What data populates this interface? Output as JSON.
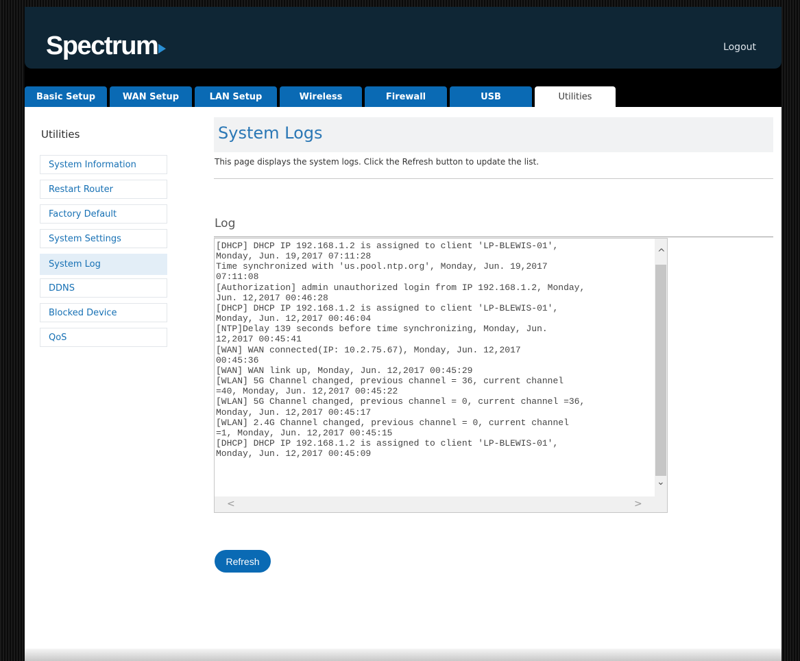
{
  "brand": {
    "logo": "Spectrum"
  },
  "header": {
    "logout": "Logout"
  },
  "tabs": [
    {
      "label": "Basic Setup"
    },
    {
      "label": "WAN Setup"
    },
    {
      "label": "LAN Setup"
    },
    {
      "label": "Wireless"
    },
    {
      "label": "Firewall"
    },
    {
      "label": "USB"
    },
    {
      "label": "Utilities"
    }
  ],
  "sidebar": {
    "title": "Utilities",
    "items": [
      {
        "label": "System Information"
      },
      {
        "label": "Restart Router"
      },
      {
        "label": "Factory Default"
      },
      {
        "label": "System Settings"
      },
      {
        "label": "System Log"
      },
      {
        "label": "DDNS"
      },
      {
        "label": "Blocked Device"
      },
      {
        "label": "QoS"
      }
    ]
  },
  "main": {
    "title": "System Logs",
    "description": "This page displays the system logs. Click the Refresh button to update the list.",
    "log_heading": "Log",
    "log_text": "[DHCP] DHCP IP 192.168.1.2 is assigned to client 'LP-BLEWIS-01',\nMonday, Jun. 19,2017 07:11:28\nTime synchronized with 'us.pool.ntp.org', Monday, Jun. 19,2017\n07:11:08\n[Authorization] admin unauthorized login from IP 192.168.1.2, Monday,\nJun. 12,2017 00:46:28\n[DHCP] DHCP IP 192.168.1.2 is assigned to client 'LP-BLEWIS-01',\nMonday, Jun. 12,2017 00:46:04\n[NTP]Delay 139 seconds before time synchronizing, Monday, Jun.\n12,2017 00:45:41\n[WAN] WAN connected(IP: 10.2.75.67), Monday, Jun. 12,2017\n00:45:36\n[WAN] WAN link up, Monday, Jun. 12,2017 00:45:29\n[WLAN] 5G Channel changed, previous channel = 36, current channel\n=40, Monday, Jun. 12,2017 00:45:22\n[WLAN] 5G Channel changed, previous channel = 0, current channel =36,\nMonday, Jun. 12,2017 00:45:17\n[WLAN] 2.4G Channel changed, previous channel = 0, current channel\n=1, Monday, Jun. 12,2017 00:45:15\n[DHCP] DHCP IP 192.168.1.2 is assigned to client 'LP-BLEWIS-01',\nMonday, Jun. 12,2017 00:45:09",
    "refresh_label": "Refresh"
  },
  "scroll_glyphs": {
    "up": "^",
    "down": "⌄",
    "left": "<",
    "right": ">"
  },
  "colors": {
    "brand_dark": "#0f2635",
    "accent_blue": "#0a6ab4",
    "link_blue": "#1670b4",
    "title_blue": "#2a77b5"
  }
}
